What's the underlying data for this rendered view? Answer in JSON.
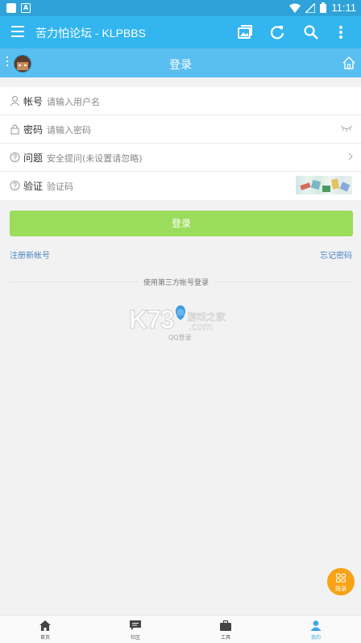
{
  "status_bar": {
    "time": "11:11",
    "notification_letter": "A"
  },
  "app_bar": {
    "title": "苦力怕论坛 - KLPBBS"
  },
  "sub_bar": {
    "title": "登录"
  },
  "form": {
    "account": {
      "label": "帐号",
      "placeholder": "请输入用户名"
    },
    "password": {
      "label": "密码",
      "placeholder": "请输入密码"
    },
    "question": {
      "label": "问题",
      "value": "安全提问(未设置请忽略)"
    },
    "captcha": {
      "label": "验证",
      "placeholder": "验证码"
    }
  },
  "login_button": "登录",
  "register_link": "注册新帐号",
  "forgot_link": "忘记密码",
  "third_party_label": "使用第三方帐号登录",
  "qq_label": "QQ登录",
  "watermark": {
    "brand": "K73",
    "site_name": "游戏之家",
    "domain": ".com"
  },
  "fab_label": "简录",
  "tabs": [
    {
      "label": "首页",
      "icon": "home-icon"
    },
    {
      "label": "社区",
      "icon": "chat-icon"
    },
    {
      "label": "工具",
      "icon": "toolbox-icon"
    },
    {
      "label": "我的",
      "icon": "person-icon"
    }
  ],
  "colors": {
    "app_bar": "#33b5f0",
    "sub_bar": "#59bef0",
    "login_button": "#9bdc5d",
    "fab": "#f8a315",
    "active_tab": "#3aa8e8"
  }
}
